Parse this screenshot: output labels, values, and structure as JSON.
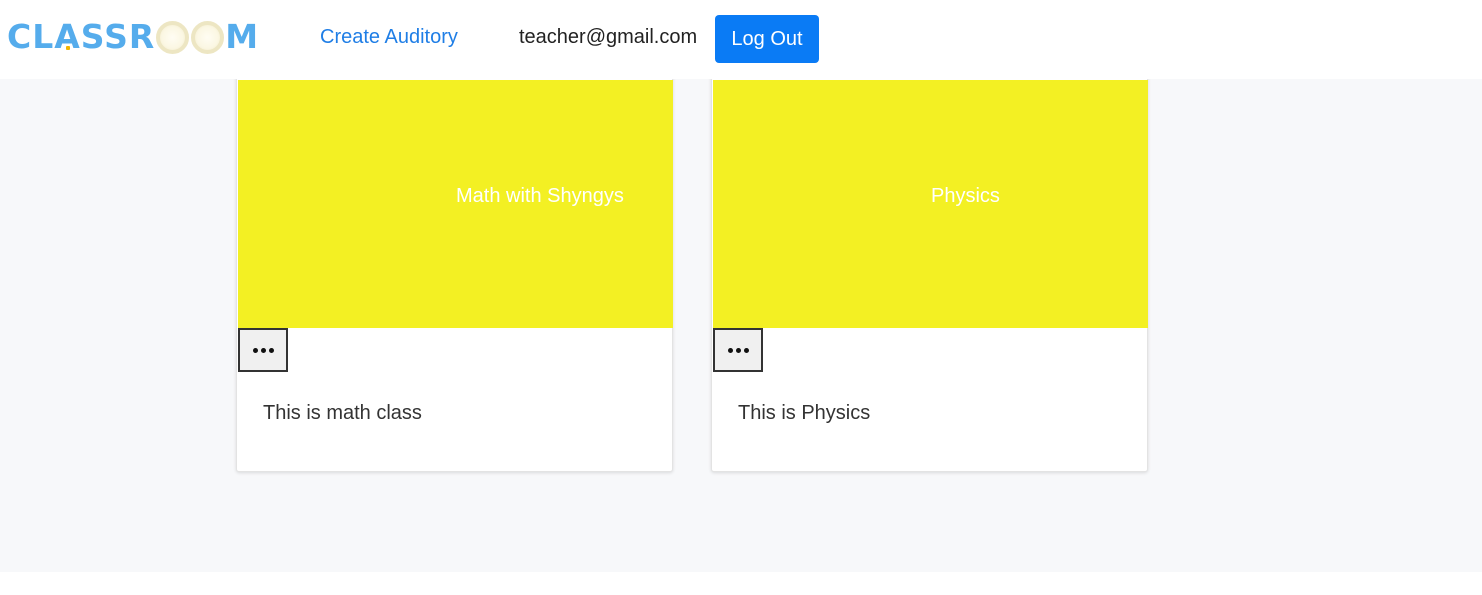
{
  "navbar": {
    "logo_text_left": "CLASSR",
    "logo_text_right": "M",
    "logo_alt": "CLASSROOM",
    "create_link": "Create Auditory",
    "user_email": "teacher@gmail.com",
    "logout_label": "Log Out"
  },
  "colors": {
    "brand": "#55acec",
    "link": "#1f7ee6",
    "button": "#0a7bf5",
    "banner": "#f3f023",
    "page_bg": "#f7f8fa"
  },
  "cards": [
    {
      "title": "Math with Shyngys",
      "description": "This is math class",
      "menu_icon": "ellipsis-icon"
    },
    {
      "title": "Physics",
      "description": "This is Physics",
      "menu_icon": "ellipsis-icon"
    }
  ]
}
